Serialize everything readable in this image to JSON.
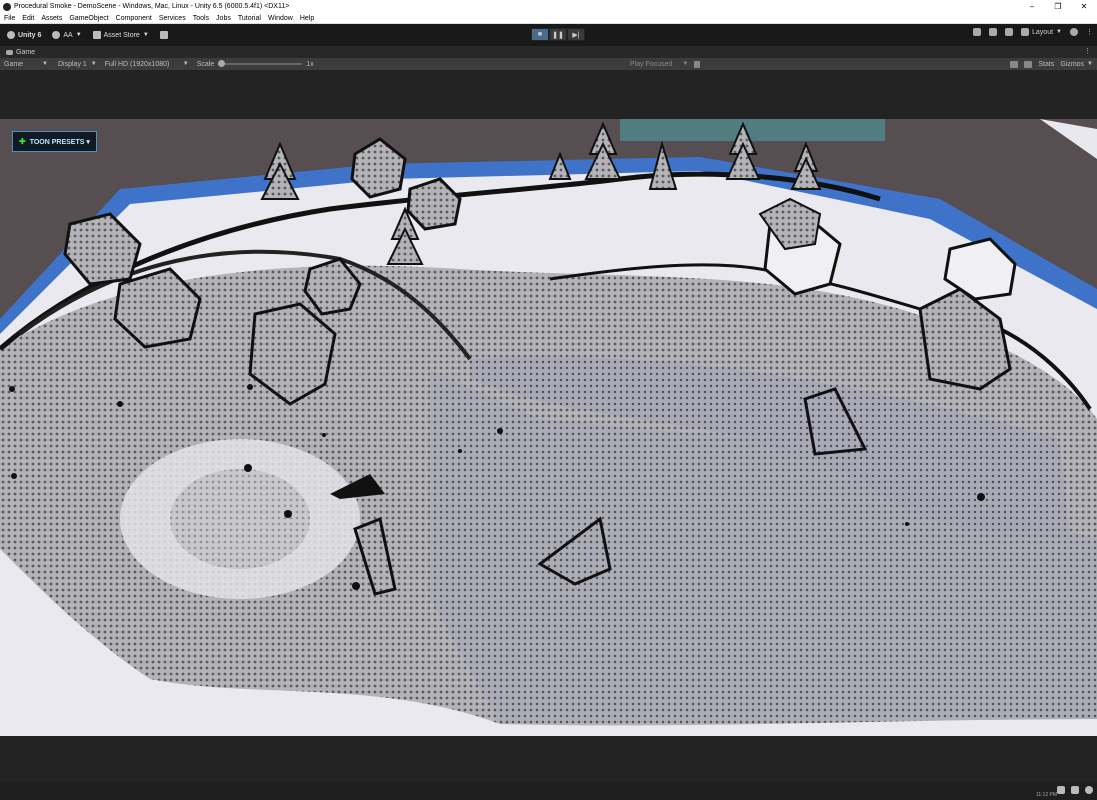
{
  "window": {
    "title": "Procedural Smoke - DemoScene - Windows, Mac, Linux - Unity 6.5 (6000.5.4f1) <DX11>",
    "controls": [
      "–",
      "❐",
      "✕"
    ]
  },
  "menu": [
    "File",
    "Edit",
    "Assets",
    "GameObject",
    "Component",
    "Services",
    "Tools",
    "Jobs",
    "Tutorial",
    "Window",
    "Help"
  ],
  "toolbar": {
    "unity_label": "Unity 6",
    "account_label": "AA",
    "asset_store_label": "Asset Store",
    "layout_label": "Layout"
  },
  "tab": {
    "label": "Game"
  },
  "gamebar": {
    "mode": "Game",
    "display": "Display 1",
    "resolution": "Full HD (1920x1080)",
    "scale_label": "Scale",
    "scale_value": "1x",
    "play_mode": "Play Focused",
    "stats_label": "Stats",
    "gizmos_label": "Gizmos"
  },
  "overlay": {
    "toon_presets_label": "TOON PRESETS ▾"
  },
  "status": {
    "time": "11:12 PM"
  },
  "colors": {
    "water_edge": "#3f73c9",
    "accent_button_border": "#4f8fc0",
    "play_active": "#4a6c8c"
  }
}
